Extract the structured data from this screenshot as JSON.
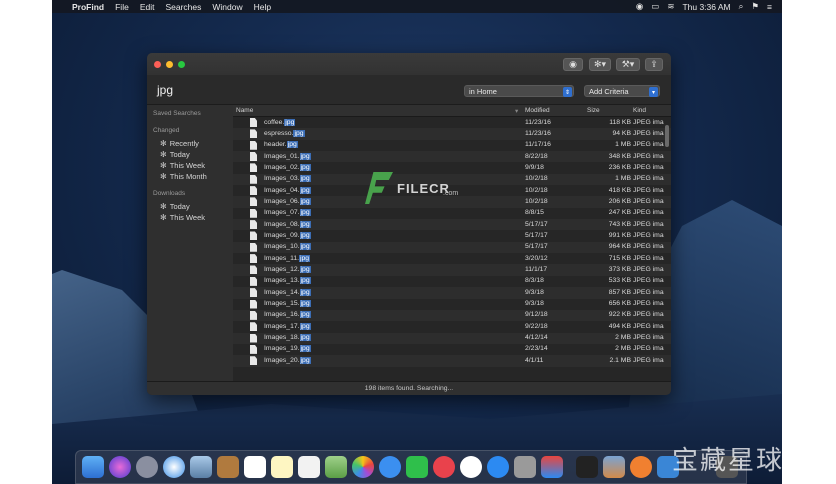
{
  "menubar": {
    "app_name": "ProFind",
    "menus": [
      "File",
      "Edit",
      "Searches",
      "Window",
      "Help"
    ],
    "clock": "Thu 3:36 AM"
  },
  "search": {
    "query": "jpg",
    "scope": "in Home",
    "add_criteria": "Add Criteria"
  },
  "sidebar": {
    "saved_searches": "Saved Searches",
    "changed_header": "Changed",
    "changed_items": [
      "Recently",
      "Today",
      "This Week",
      "This Month"
    ],
    "downloads_header": "Downloads",
    "downloads_items": [
      "Today",
      "This Week"
    ]
  },
  "table": {
    "columns": [
      "Name",
      "Modified",
      "Size",
      "Kind"
    ],
    "rows": [
      {
        "base": "coffee.",
        "ext": "jpg",
        "modified": "11/23/16",
        "size": "118 KB",
        "kind": "JPEG ima"
      },
      {
        "base": "espresso.",
        "ext": "jpg",
        "modified": "11/23/16",
        "size": "94 KB",
        "kind": "JPEG ima"
      },
      {
        "base": "header.",
        "ext": "jpg",
        "modified": "11/17/16",
        "size": "1 MB",
        "kind": "JPEG ima"
      },
      {
        "base": "Images_01.",
        "ext": "jpg",
        "modified": "8/22/18",
        "size": "348 KB",
        "kind": "JPEG ima"
      },
      {
        "base": "Images_02.",
        "ext": "jpg",
        "modified": "9/9/18",
        "size": "236 KB",
        "kind": "JPEG ima"
      },
      {
        "base": "Images_03.",
        "ext": "jpg",
        "modified": "10/2/18",
        "size": "1 MB",
        "kind": "JPEG ima"
      },
      {
        "base": "Images_04.",
        "ext": "jpg",
        "modified": "10/2/18",
        "size": "418 KB",
        "kind": "JPEG ima"
      },
      {
        "base": "Images_06.",
        "ext": "jpg",
        "modified": "10/2/18",
        "size": "206 KB",
        "kind": "JPEG ima"
      },
      {
        "base": "Images_07.",
        "ext": "jpg",
        "modified": "8/8/15",
        "size": "247 KB",
        "kind": "JPEG ima"
      },
      {
        "base": "Images_08.",
        "ext": "jpg",
        "modified": "5/17/17",
        "size": "743 KB",
        "kind": "JPEG ima"
      },
      {
        "base": "Images_09.",
        "ext": "jpg",
        "modified": "5/17/17",
        "size": "991 KB",
        "kind": "JPEG ima"
      },
      {
        "base": "Images_10.",
        "ext": "jpg",
        "modified": "5/17/17",
        "size": "964 KB",
        "kind": "JPEG ima"
      },
      {
        "base": "Images_11.",
        "ext": "jpg",
        "modified": "3/20/12",
        "size": "715 KB",
        "kind": "JPEG ima"
      },
      {
        "base": "Images_12.",
        "ext": "jpg",
        "modified": "11/1/17",
        "size": "373 KB",
        "kind": "JPEG ima"
      },
      {
        "base": "Images_13.",
        "ext": "jpg",
        "modified": "8/3/18",
        "size": "533 KB",
        "kind": "JPEG ima"
      },
      {
        "base": "Images_14.",
        "ext": "jpg",
        "modified": "9/3/18",
        "size": "857 KB",
        "kind": "JPEG ima"
      },
      {
        "base": "Images_15.",
        "ext": "jpg",
        "modified": "9/3/18",
        "size": "656 KB",
        "kind": "JPEG ima"
      },
      {
        "base": "Images_16.",
        "ext": "jpg",
        "modified": "9/12/18",
        "size": "922 KB",
        "kind": "JPEG ima"
      },
      {
        "base": "Images_17.",
        "ext": "jpg",
        "modified": "9/22/18",
        "size": "494 KB",
        "kind": "JPEG ima"
      },
      {
        "base": "Images_18.",
        "ext": "jpg",
        "modified": "4/12/14",
        "size": "2 MB",
        "kind": "JPEG ima"
      },
      {
        "base": "Images_19.",
        "ext": "jpg",
        "modified": "2/23/14",
        "size": "2 MB",
        "kind": "JPEG ima"
      },
      {
        "base": "Images_20.",
        "ext": "jpg",
        "modified": "4/1/11",
        "size": "2.1 MB",
        "kind": "JPEG ima"
      }
    ]
  },
  "status": "198 items found. Searching...",
  "watermark": {
    "brand": "FILECR",
    "sub": ".com",
    "cn": "宝藏星球屋"
  },
  "colors": {
    "accent": "#3b6db5",
    "close": "#fc5f57",
    "minimize": "#fdbc2e",
    "zoom": "#28c840"
  }
}
